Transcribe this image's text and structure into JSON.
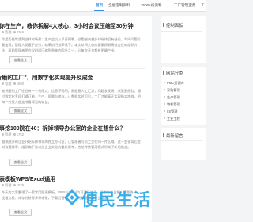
{
  "nav": {
    "items": [
      "首页",
      "全屋定制资料",
      "3500+份资料",
      "工厂管理宝典",
      "工"
    ],
    "active_index": 0
  },
  "articles": [
    {
      "title": "想你在生产，教你拆解4大核心，3小时会议压缩至30分钟",
      "meta_author": "管理",
      "meta_views": "2366",
      "desc": "你是否经常遇到这样的场景：生产会议从早开到晚，议题越来越多却始终没有结论，车间问题反复出现，管理人员疲于应付，结果执行效率低下。本文从四大核心要素拆解高效会议的组织方法，帮助管理者把会议时间压缩到原来的四分之一，让每次开会都有明确产出。",
      "more_label": "查看全文"
    },
    {
      "title": "\"折磨的工厂\"，用数字化实现提升及成金",
      "meta_author": "管理",
      "meta_views": "1980",
      "desc": "被折磨的工厂往往有一个共同点：信息不透明，数据靠人工汇总，问题发现晚，决策靠经验。通过数字化手段打通订单、生产、质量与库存，让数据实时可见，工厂才能真正实现降本增效，把每一分投入都变成看得见的收益。",
      "more_label": "查看全文"
    },
    {
      "title": "下事挖100院在40：拆掉领导办公室的企业在想什么？",
      "meta_author": "管理",
      "meta_views": "1752",
      "desc": "越来越多的企业开始拆掉领导的独立办公室，让管理者与员工坐在同一片区域。这一变化背后是对沟通效率、组织扁平化以及企业文化的重新思考，也给传统管理模式带来了新的挑战。",
      "more_label": "查看全文"
    },
    {
      "title": "图表模板WPS/Excel通用",
      "meta_author": "管理",
      "meta_views": "1536",
      "desc": "今天为大家整理了一套常用图表模板，WPS与Excel均可直接使用，涵盖生产日报、质量统计、设备点检、库存分析等多种场景，下载后替换数据即可快速生成专业报表。",
      "more_label": "查看全文"
    }
  ],
  "sidebar": {
    "panel_title": "控制面板",
    "nav_title": "网站分类",
    "categories": [
      "PMC资源库",
      "采购管理",
      "生产管理",
      "物料管理",
      "5S管理",
      "工业工程"
    ],
    "recent_title": "最新留言"
  },
  "watermark": {
    "text": "便民生活",
    "icon": "diamond-logo-icon"
  },
  "colors": {
    "accent": "#3a8ee6",
    "page_bg": "#f3f4f6",
    "watermark": "#29a8e8"
  }
}
